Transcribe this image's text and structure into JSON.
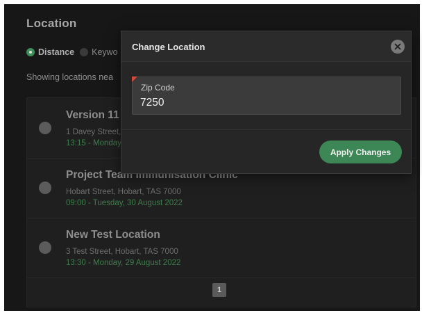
{
  "panel": {
    "title": "Location",
    "search_mode": {
      "options": [
        "Distance",
        "Keywo"
      ],
      "selected": "Distance"
    },
    "showing_text": "Showing locations nea"
  },
  "locations": [
    {
      "name": "Version 11 I",
      "address": "1 Davey Street,",
      "time": "13:15 - Monday"
    },
    {
      "name": "Project Team Immunisation Clinic",
      "address": "Hobart Street, Hobart, TAS 7000",
      "time": "09:00 - Tuesday, 30 August 2022"
    },
    {
      "name": "New Test Location",
      "address": "3 Test Street, Hobart, TAS 7000",
      "time": "13:30 - Monday, 29 August 2022"
    }
  ],
  "pagination": {
    "current_page": "1"
  },
  "modal": {
    "title": "Change Location",
    "zip_label": "Zip Code",
    "zip_value": "7250",
    "apply_label": "Apply Changes",
    "close_icon": "close-icon"
  },
  "colors": {
    "background": "#171717",
    "accent_green": "#3c8755",
    "time_green": "#3f7d4d",
    "required_marker": "#d9473a"
  }
}
